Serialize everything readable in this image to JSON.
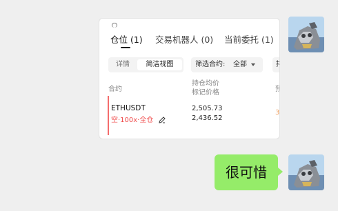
{
  "messages": [
    {
      "type": "image",
      "screenshot": {
        "tabs": [
          {
            "label": "仓位 (1)",
            "active": true
          },
          {
            "label": "交易机器人 (0)",
            "active": false
          },
          {
            "label": "当前委托 (1)",
            "active": false
          }
        ],
        "segment": {
          "inactive": "详情",
          "active": "简洁视图"
        },
        "filter": {
          "label": "筛选合约:",
          "value": "全部"
        },
        "filter2_fragment": "排",
        "headers": {
          "contract": "合约",
          "avg_price": "持仓均价",
          "mark_price": "标记价格",
          "col3_fragment": "预"
        },
        "row": {
          "symbol": "ETHUSDT",
          "position": "空·100x·全仓",
          "avg_price": "2,505.73",
          "mark_price": "2,436.52",
          "col3_fragment": "3"
        }
      }
    },
    {
      "type": "text",
      "text": "很可惜"
    }
  ],
  "colors": {
    "bubble": "#95ec69",
    "short": "#f04e4e",
    "chat_bg": "#efefef"
  },
  "icons": [
    "user-avatar",
    "pencil-icon",
    "chevron-down-icon"
  ]
}
